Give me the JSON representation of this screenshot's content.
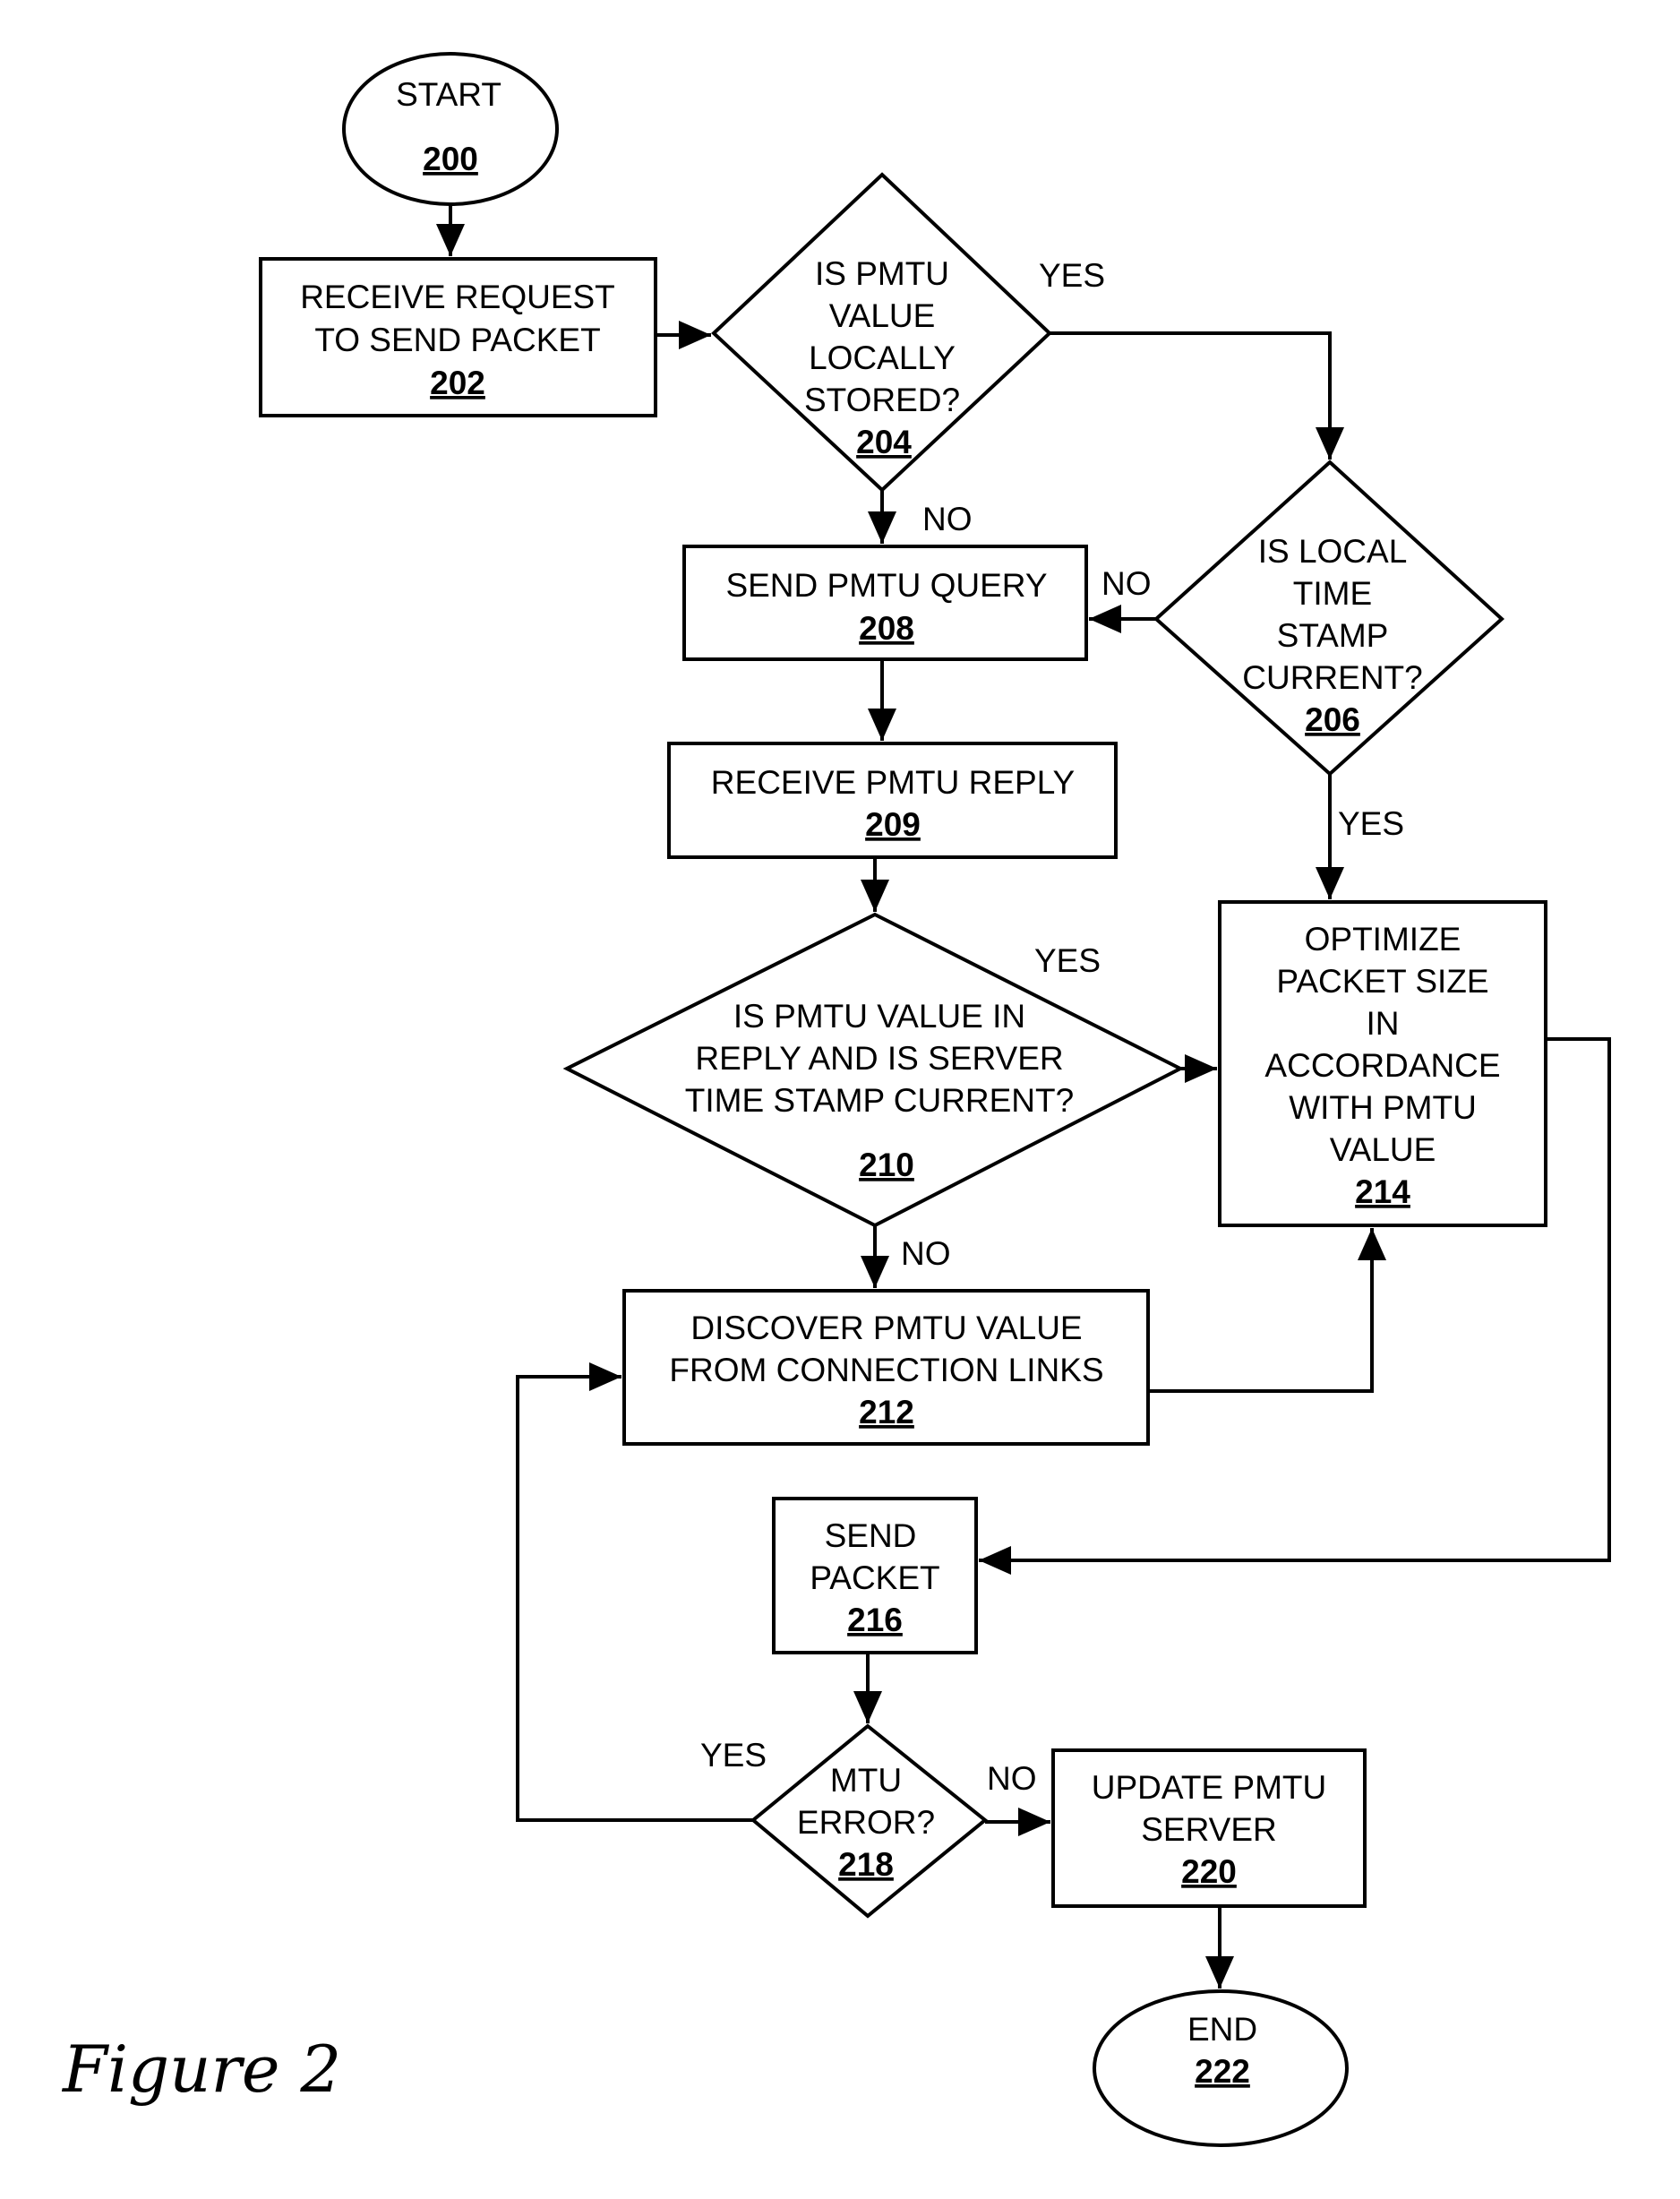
{
  "figure_label": "Figure 2",
  "nodes": {
    "n200": {
      "type": "terminator",
      "lines": [
        "START"
      ],
      "ref": "200"
    },
    "n202": {
      "type": "process",
      "lines": [
        "RECEIVE REQUEST",
        "TO SEND PACKET"
      ],
      "ref": "202"
    },
    "n204": {
      "type": "decision",
      "lines": [
        "IS PMTU",
        "VALUE",
        "LOCALLY",
        "STORED?"
      ],
      "ref": "204"
    },
    "n206": {
      "type": "decision",
      "lines": [
        "IS LOCAL",
        "TIME",
        "STAMP",
        "CURRENT?"
      ],
      "ref": "206"
    },
    "n208": {
      "type": "process",
      "lines": [
        "SEND PMTU QUERY"
      ],
      "ref": "208"
    },
    "n209": {
      "type": "process",
      "lines": [
        "RECEIVE PMTU REPLY"
      ],
      "ref": "209"
    },
    "n210": {
      "type": "decision",
      "lines": [
        "IS PMTU VALUE IN",
        "REPLY AND IS SERVER",
        "TIME STAMP CURRENT?"
      ],
      "ref": "210"
    },
    "n212": {
      "type": "process",
      "lines": [
        "DISCOVER PMTU VALUE",
        "FROM CONNECTION LINKS"
      ],
      "ref": "212"
    },
    "n214": {
      "type": "process",
      "lines": [
        "OPTIMIZE",
        "PACKET SIZE",
        "IN",
        "ACCORDANCE",
        "WITH PMTU",
        "VALUE"
      ],
      "ref": "214"
    },
    "n216": {
      "type": "process",
      "lines": [
        "SEND",
        "PACKET"
      ],
      "ref": "216"
    },
    "n218": {
      "type": "decision",
      "lines": [
        "MTU",
        "ERROR?"
      ],
      "ref": "218"
    },
    "n220": {
      "type": "process",
      "lines": [
        "UPDATE PMTU",
        "SERVER"
      ],
      "ref": "220"
    },
    "n222": {
      "type": "terminator",
      "lines": [
        "END"
      ],
      "ref": "222"
    }
  },
  "edges": [
    {
      "from": "200",
      "to": "202",
      "label": ""
    },
    {
      "from": "202",
      "to": "204",
      "label": ""
    },
    {
      "from": "204",
      "to": "206",
      "label": "YES"
    },
    {
      "from": "204",
      "to": "208",
      "label": "NO"
    },
    {
      "from": "206",
      "to": "208",
      "label": "NO"
    },
    {
      "from": "206",
      "to": "214",
      "label": "YES"
    },
    {
      "from": "208",
      "to": "209",
      "label": ""
    },
    {
      "from": "209",
      "to": "210",
      "label": ""
    },
    {
      "from": "210",
      "to": "214",
      "label": "YES"
    },
    {
      "from": "210",
      "to": "212",
      "label": "NO"
    },
    {
      "from": "212",
      "to": "214",
      "label": ""
    },
    {
      "from": "214",
      "to": "216",
      "label": ""
    },
    {
      "from": "216",
      "to": "218",
      "label": ""
    },
    {
      "from": "218",
      "to": "212",
      "label": "YES"
    },
    {
      "from": "218",
      "to": "220",
      "label": "NO"
    },
    {
      "from": "220",
      "to": "222",
      "label": ""
    }
  ]
}
